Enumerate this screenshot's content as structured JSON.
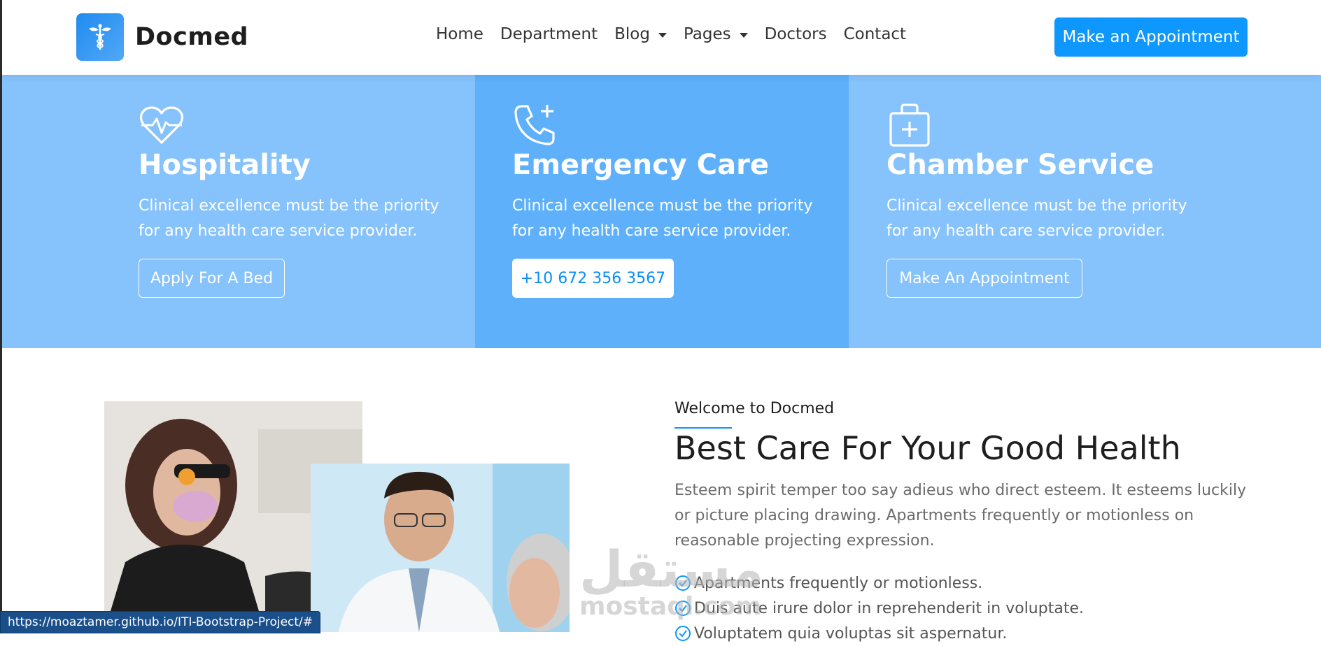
{
  "brand": {
    "name": "Docmed",
    "logo_icon": "caduceus-icon"
  },
  "nav": {
    "items": [
      {
        "label": "Home",
        "dropdown": false
      },
      {
        "label": "Department",
        "dropdown": false
      },
      {
        "label": "Blog",
        "dropdown": true
      },
      {
        "label": "Pages",
        "dropdown": true
      },
      {
        "label": "Doctors",
        "dropdown": false
      },
      {
        "label": "Contact",
        "dropdown": false
      }
    ],
    "cta_label": "Make an Appointment"
  },
  "features": [
    {
      "icon": "heart-pulse-icon",
      "title": "Hospitality",
      "desc": "Clinical excellence must be the priority for any health care service provider.",
      "button": "Apply For A Bed",
      "color": "#86c2fb"
    },
    {
      "icon": "phone-plus-icon",
      "title": "Emergency Care",
      "desc": "Clinical excellence must be the priority for any health care service provider.",
      "button": "+10 672 356 3567",
      "color": "#5eb0fb"
    },
    {
      "icon": "medical-bag-icon",
      "title": "Chamber Service",
      "desc": "Clinical excellence must be the priority for any health care service provider.",
      "button": "Make An Appointment",
      "color": "#86c2fb"
    }
  ],
  "about": {
    "welcome": "Welcome to Docmed",
    "title": "Best Care For Your Good Health",
    "text": "Esteem spirit temper too say adieus who direct esteem. It esteems luckily or picture placing drawing. Apartments frequently or motionless on reasonable projecting expression.",
    "checks": [
      "Apartments frequently or motionless.",
      "Duis aute irure dolor in reprehenderit in voluptate.",
      "Voluptatem quia voluptas sit aspernatur."
    ]
  },
  "watermark": {
    "arabic": "مستقل",
    "latin": "mostaql.com"
  },
  "status_url": "https://moaztamer.github.io/ITI-Bootstrap-Project/#",
  "colors": {
    "primary": "#0d97ff",
    "feature_light": "#86c2fb",
    "feature_mid": "#5eb0fb"
  }
}
